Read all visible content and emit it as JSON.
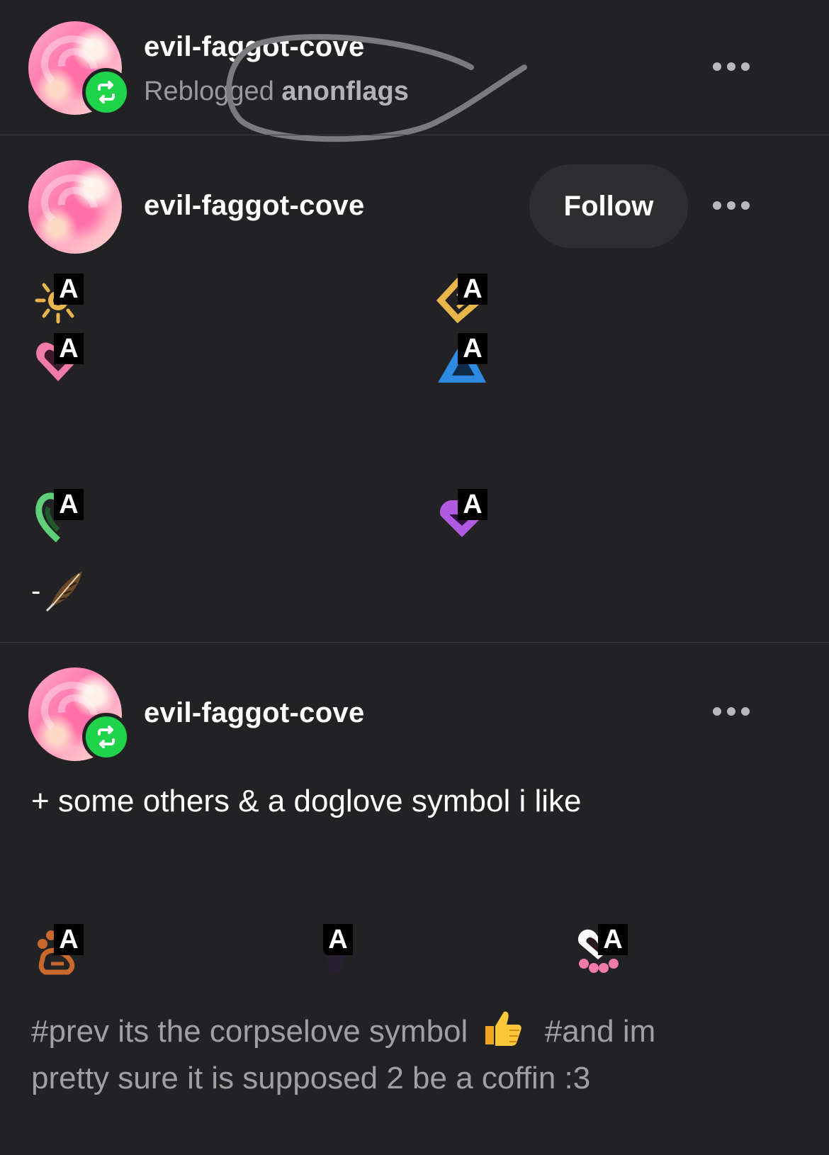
{
  "post1": {
    "username": "evil-faggot-cove",
    "reblogged_prefix": "Reblogged",
    "reblogged_from": "anonflags"
  },
  "post2": {
    "username": "evil-faggot-cove",
    "follow_label": "Follow",
    "symbol_badge": "A",
    "dash_text": "-",
    "symbols": [
      "sun-symbol",
      "diamond-symbol",
      "heart-symbol",
      "triangle-symbol",
      "green-heart-symbol",
      "purple-heart-symbol",
      "feather-emoji"
    ]
  },
  "post3": {
    "username": "evil-faggot-cove",
    "text": "+ some others & a doglove symbol i like",
    "symbols": [
      "paw-symbol",
      "coffin-symbol",
      "pink-paw-heart-symbol"
    ],
    "tags_line1_a": "#prev its the corpselove symbol",
    "tags_line1_b": "#and im",
    "tags_line2": "pretty sure it is supposed 2 be a coffin :3",
    "thumbs_up_emoji": "👍"
  },
  "colors": {
    "background": "#222224",
    "reblog_green": "#1fd34b",
    "muted_text": "#9a9a9d",
    "follow_button_bg": "#2e2e30"
  }
}
